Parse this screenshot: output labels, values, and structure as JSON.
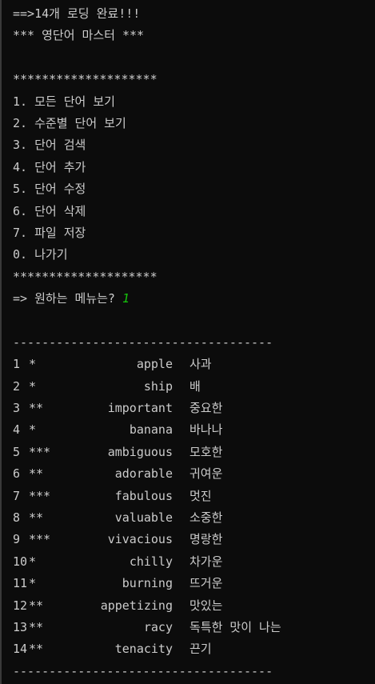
{
  "header": {
    "loading": "==>14개 로딩 완료!!!",
    "title": "*** 영단어 마스터 ***"
  },
  "menu": {
    "border": "********************",
    "items": [
      "1. 모든 단어 보기",
      "2. 수준별 단어 보기",
      "3. 단어 검색",
      "4. 단어 추가",
      "5. 단어 수정",
      "6. 단어 삭제",
      "7. 파일 저장",
      "0. 나가기"
    ],
    "prompt": "=> 원하는 메뉴는? ",
    "input": "1"
  },
  "list": {
    "divider": "------------------------------------",
    "words": [
      {
        "num": "1",
        "level": "*",
        "word": "apple",
        "meaning": "사과"
      },
      {
        "num": "2",
        "level": "*",
        "word": "ship",
        "meaning": "배"
      },
      {
        "num": "3",
        "level": "**",
        "word": "important",
        "meaning": "중요한"
      },
      {
        "num": "4",
        "level": "*",
        "word": "banana",
        "meaning": "바나나"
      },
      {
        "num": "5",
        "level": "***",
        "word": "ambiguous",
        "meaning": "모호한"
      },
      {
        "num": "6",
        "level": "**",
        "word": "adorable",
        "meaning": "귀여운"
      },
      {
        "num": "7",
        "level": "***",
        "word": "fabulous",
        "meaning": "멋진"
      },
      {
        "num": "8",
        "level": "**",
        "word": "valuable",
        "meaning": "소중한"
      },
      {
        "num": "9",
        "level": "***",
        "word": "vivacious",
        "meaning": "명랑한"
      },
      {
        "num": "10",
        "level": "*",
        "word": "chilly",
        "meaning": "차가운"
      },
      {
        "num": "11",
        "level": "*",
        "word": "burning",
        "meaning": "뜨거운"
      },
      {
        "num": "12",
        "level": "**",
        "word": "appetizing",
        "meaning": "맛있는"
      },
      {
        "num": "13",
        "level": "**",
        "word": "racy",
        "meaning": "독특한 맛이 나는"
      },
      {
        "num": "14",
        "level": "**",
        "word": "tenacity",
        "meaning": "끈기"
      }
    ]
  },
  "colors": {
    "background": "#0c0c0c",
    "text": "#cccccc",
    "input": "#16c60c"
  }
}
